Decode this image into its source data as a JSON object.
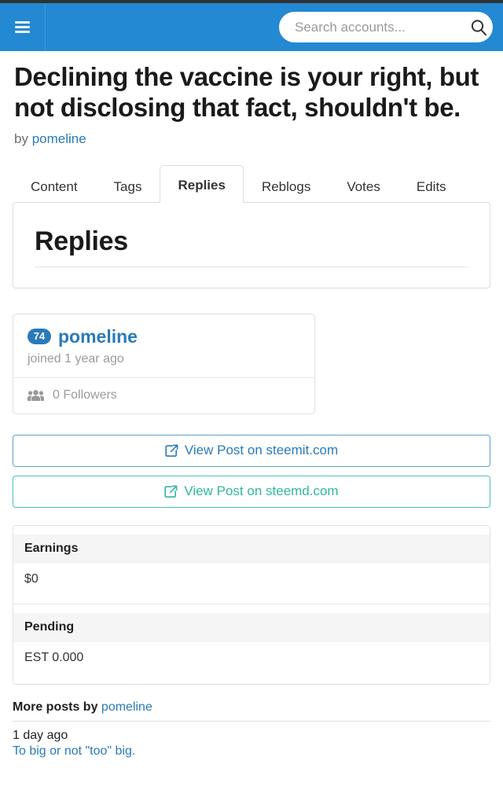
{
  "navbar": {
    "menu_icon": "hamburger-icon",
    "search": {
      "placeholder": "Search accounts...",
      "value": "",
      "icon": "search-icon"
    },
    "background_color": "#2389d2"
  },
  "post": {
    "title": "Declining the vaccine is your right, but not disclosing that fact, shouldn't be.",
    "by_label": "by",
    "author": "pomeline"
  },
  "tabs": [
    {
      "label": "Content",
      "active": false
    },
    {
      "label": "Tags",
      "active": false
    },
    {
      "label": "Replies",
      "active": true
    },
    {
      "label": "Reblogs",
      "active": false
    },
    {
      "label": "Votes",
      "active": false
    },
    {
      "label": "Edits",
      "active": false
    }
  ],
  "panel": {
    "heading": "Replies"
  },
  "author_card": {
    "reputation": "74",
    "name": "pomeline",
    "joined": "joined 1 year ago",
    "followers_icon": "users-icon",
    "followers": "0 Followers"
  },
  "link_buttons": [
    {
      "label": "View Post on steemit.com",
      "icon": "external-link-icon",
      "color": "#2a7ab9"
    },
    {
      "label": "View Post on steemd.com",
      "icon": "external-link-icon",
      "color": "#31b79f"
    }
  ],
  "earnings": {
    "rows": [
      {
        "header": "Earnings",
        "value": "$0"
      },
      {
        "header": "Pending",
        "value": "EST 0.000"
      }
    ]
  },
  "more_posts": {
    "title_prefix": "More posts by",
    "author": "pomeline",
    "items": [
      {
        "date": "1 day ago",
        "title": "To big or not \"too\" big."
      }
    ]
  }
}
